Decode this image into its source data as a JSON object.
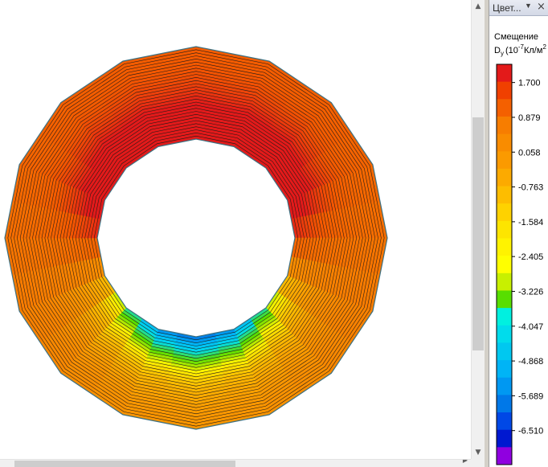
{
  "panel": {
    "title": "Цвет...",
    "dropdown_icon": "dropdown-arrow-icon",
    "close_icon": "close-icon"
  },
  "legend": {
    "title": "Смещение",
    "quantity": "D",
    "quantity_subscript": "y",
    "unit_prefix": "(10",
    "unit_exponent": "-7",
    "unit_suffix": "Кл/м",
    "unit_power": "2",
    "labels": [
      "1.700",
      "0.879",
      "0.058",
      "-0.763",
      "-1.584",
      "-2.405",
      "-3.226",
      "-4.047",
      "-4.868",
      "-5.689",
      "-6.510"
    ],
    "colors": [
      "#e31a1a",
      "#f04000",
      "#f46000",
      "#f77d00",
      "#f98c00",
      "#fb9a00",
      "#fcaa00",
      "#fdbd00",
      "#fed200",
      "#fde500",
      "#fff300",
      "#ffff00",
      "#c8f000",
      "#58de00",
      "#00f0e0",
      "#00dcec",
      "#00c8f0",
      "#00b4f6",
      "#0098f2",
      "#0078e8",
      "#0048e6",
      "#0018d0",
      "#9000e0"
    ]
  },
  "plot": {
    "colormap_stops": [
      {
        "v": -6.51,
        "c": "#0018d0"
      },
      {
        "v": -5.689,
        "c": "#0078e8"
      },
      {
        "v": -4.868,
        "c": "#00b4f6"
      },
      {
        "v": -4.047,
        "c": "#00dcec"
      },
      {
        "v": -3.226,
        "c": "#58de00"
      },
      {
        "v": -2.405,
        "c": "#fff300"
      },
      {
        "v": -1.584,
        "c": "#fdbd00"
      },
      {
        "v": -0.763,
        "c": "#fb9a00"
      },
      {
        "v": 0.058,
        "c": "#f77d00"
      },
      {
        "v": 0.879,
        "c": "#f45a00"
      },
      {
        "v": 1.7,
        "c": "#e31a1a"
      }
    ]
  }
}
